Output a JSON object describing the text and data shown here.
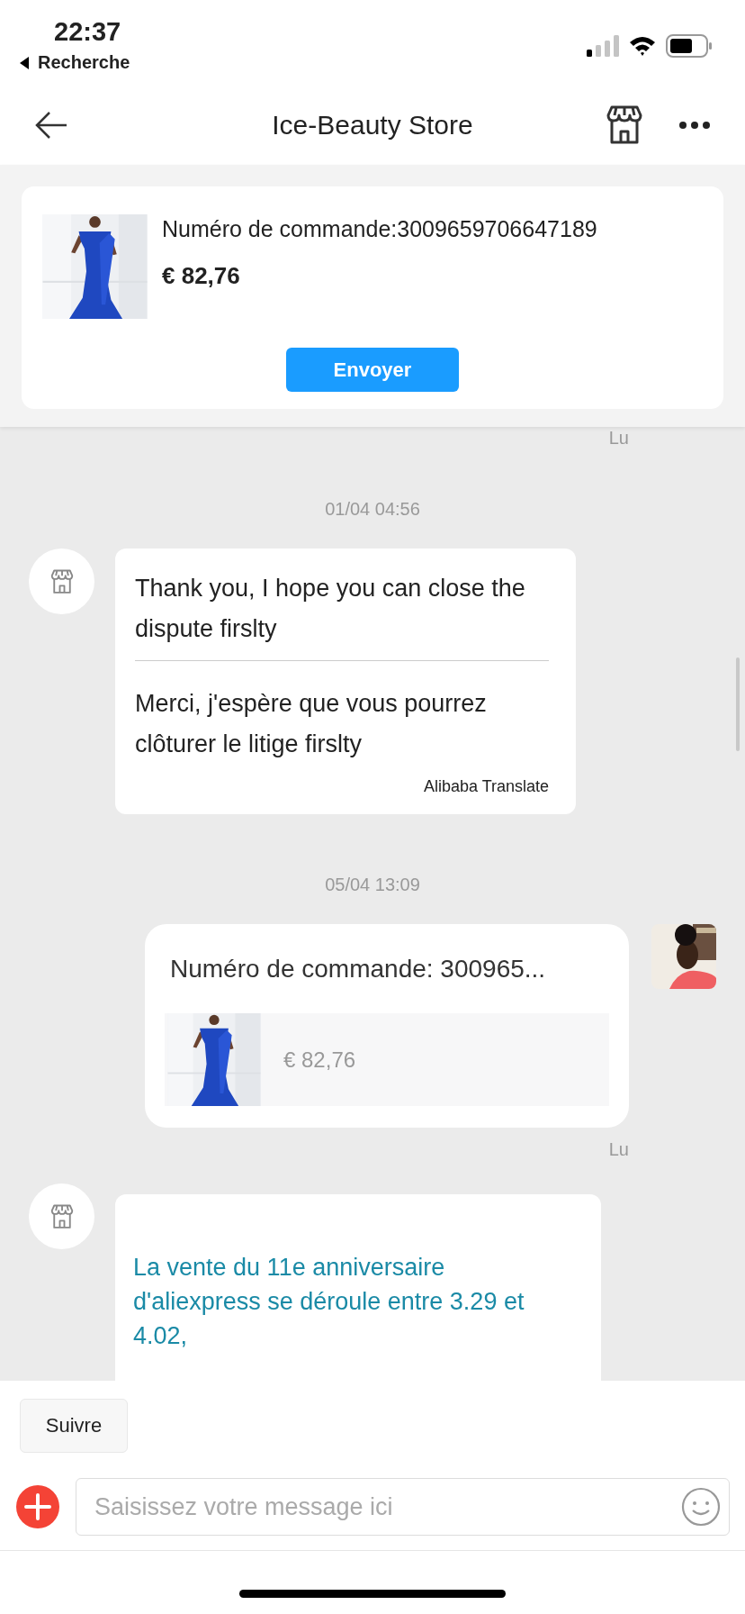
{
  "status_bar": {
    "time": "22:37",
    "back_label": "Recherche"
  },
  "header": {
    "title": "Ice-Beauty Store"
  },
  "order_card": {
    "order_number": "Numéro de commande:3009659706647189",
    "price": "€ 82,76",
    "button": "Envoyer"
  },
  "messages": [
    {
      "kind": "read_receipt",
      "text": "Lu"
    },
    {
      "kind": "timestamp",
      "text": "01/04 04:56"
    },
    {
      "kind": "incoming_translated",
      "original": "Thank you, I hope you can close the dispute firslty",
      "translation": "Merci, j'espère que vous pourrez clôturer le litige firslty",
      "source": "Alibaba Translate"
    },
    {
      "kind": "timestamp",
      "text": "05/04 13:09"
    },
    {
      "kind": "outgoing_order",
      "title": "Numéro de commande: 300965...",
      "price": "€ 82,76"
    },
    {
      "kind": "read_receipt",
      "text": "Lu"
    },
    {
      "kind": "incoming_link",
      "text": "La vente du 11e anniversaire d'aliexpress se déroule entre 3.29 et 4.02,"
    }
  ],
  "quick_replies": [
    "Suivre"
  ],
  "composer": {
    "placeholder": "Saisissez votre message ici"
  }
}
